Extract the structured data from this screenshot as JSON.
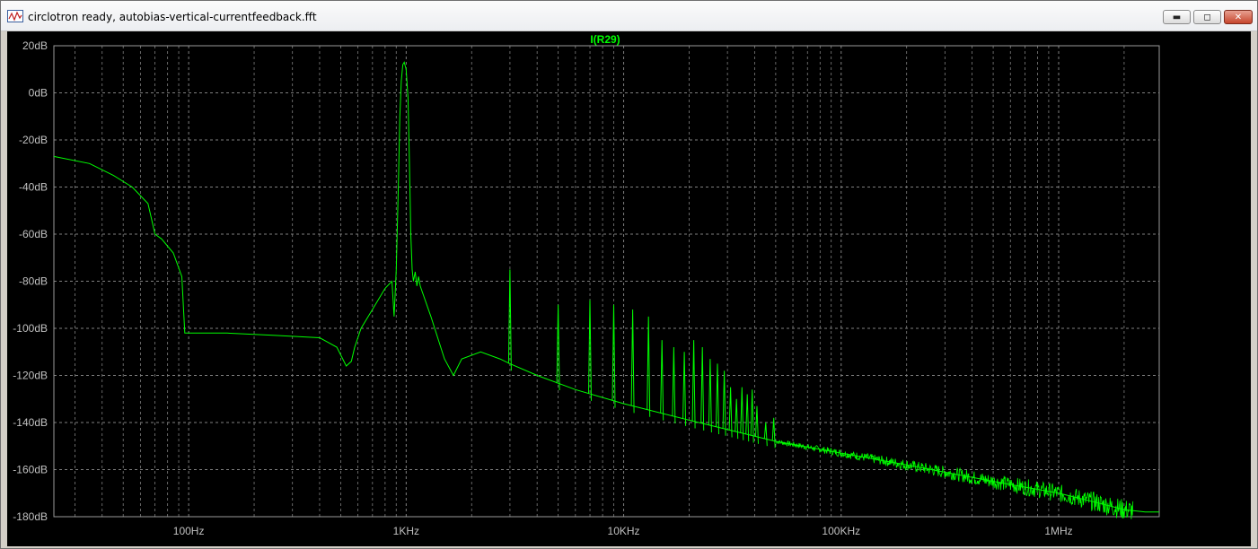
{
  "window": {
    "title": "circlotron ready, autobias-vertical-currentfeedback.fft",
    "buttons": {
      "minimize": "▬",
      "maximize": "◻",
      "close": "✕"
    }
  },
  "colors": {
    "plot_bg": "#000000",
    "trace": "#00ff00",
    "grid": "#7f7f7f",
    "axis_text": "#c0c0c0"
  },
  "chart_data": {
    "type": "line",
    "title": "I(R29)",
    "x_scale": "log",
    "xlim": [
      24,
      2900000
    ],
    "ylim": [
      -180,
      20
    ],
    "x_ticks": [
      {
        "value": 100,
        "label": "100Hz"
      },
      {
        "value": 1000,
        "label": "1KHz"
      },
      {
        "value": 10000,
        "label": "10KHz"
      },
      {
        "value": 100000,
        "label": "100KHz"
      },
      {
        "value": 1000000,
        "label": "1MHz"
      }
    ],
    "y_ticks": [
      {
        "value": 20,
        "label": "20dB"
      },
      {
        "value": 0,
        "label": "0dB"
      },
      {
        "value": -20,
        "label": "-20dB"
      },
      {
        "value": -40,
        "label": "-40dB"
      },
      {
        "value": -60,
        "label": "-60dB"
      },
      {
        "value": -80,
        "label": "-80dB"
      },
      {
        "value": -100,
        "label": "-100dB"
      },
      {
        "value": -120,
        "label": "-120dB"
      },
      {
        "value": -140,
        "label": "-140dB"
      },
      {
        "value": -160,
        "label": "-160dB"
      },
      {
        "value": -180,
        "label": "-180dB"
      }
    ],
    "grid": true,
    "series": [
      {
        "name": "I(R29)",
        "x": [
          24,
          35,
          45,
          55,
          65,
          70,
          75,
          85,
          93,
          96,
          100,
          150,
          250,
          400,
          480,
          530,
          560,
          580,
          620,
          700,
          800,
          860,
          880,
          900,
          920,
          935,
          950,
          965,
          980,
          1000,
          1020,
          1035,
          1050,
          1065,
          1080,
          1100,
          1120,
          1140,
          1160,
          1180,
          1300,
          1500,
          1650,
          1800,
          2200,
          2700,
          3000,
          4000,
          6000,
          10000,
          20000,
          50000,
          100000,
          200000,
          500000,
          1000000,
          1500000,
          2000000,
          2500000,
          2900000
        ],
        "y": [
          -27,
          -30,
          -35,
          -40,
          -47,
          -60,
          -62,
          -68,
          -78,
          -102,
          -102,
          -102,
          -103,
          -104,
          -108,
          -116,
          -114,
          -108,
          -100,
          -92,
          -83,
          -80,
          -95,
          -75,
          -40,
          -10,
          5,
          12,
          13,
          10,
          -2,
          -30,
          -60,
          -75,
          -80,
          -76,
          -82,
          -78,
          -82,
          -84,
          -95,
          -113,
          -120,
          -113,
          -110,
          -113,
          -115,
          -120,
          -126,
          -132,
          -139,
          -148,
          -153,
          -158,
          -165,
          -170,
          -174,
          -177,
          -178,
          -178
        ]
      }
    ],
    "harmonic_spikes": [
      {
        "x": 3000,
        "peak": -75
      },
      {
        "x": 5000,
        "peak": -90
      },
      {
        "x": 7000,
        "peak": -88
      },
      {
        "x": 9000,
        "peak": -90
      },
      {
        "x": 11000,
        "peak": -92
      },
      {
        "x": 13000,
        "peak": -95
      },
      {
        "x": 15000,
        "peak": -105
      },
      {
        "x": 17000,
        "peak": -108
      },
      {
        "x": 19000,
        "peak": -110
      },
      {
        "x": 21000,
        "peak": -105
      },
      {
        "x": 23000,
        "peak": -108
      },
      {
        "x": 25000,
        "peak": -113
      },
      {
        "x": 27000,
        "peak": -115
      },
      {
        "x": 29000,
        "peak": -118
      },
      {
        "x": 31000,
        "peak": -125
      },
      {
        "x": 33000,
        "peak": -130
      },
      {
        "x": 35000,
        "peak": -125
      },
      {
        "x": 37000,
        "peak": -128
      },
      {
        "x": 39000,
        "peak": -126
      },
      {
        "x": 41000,
        "peak": -133
      },
      {
        "x": 45000,
        "peak": -140
      },
      {
        "x": 49000,
        "peak": -138
      }
    ]
  }
}
